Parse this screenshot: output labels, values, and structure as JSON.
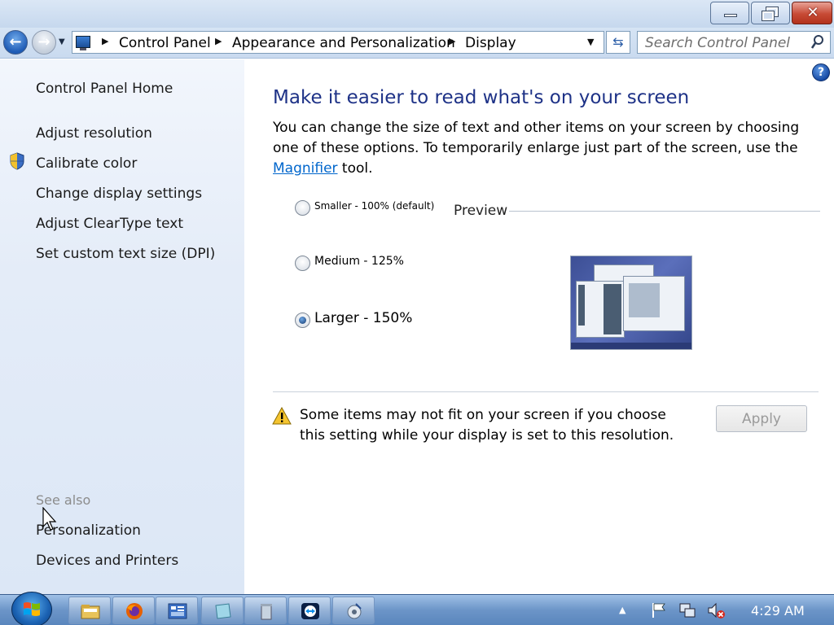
{
  "window": {
    "minimize_label": "",
    "close_glyph": "✕"
  },
  "nav": {
    "back_glyph": "←",
    "forward_glyph": "→",
    "breadcrumbs": [
      "Control Panel",
      "Appearance and Personalization",
      "Display"
    ],
    "search_placeholder": "Search Control Panel"
  },
  "sidebar": {
    "home": "Control Panel Home",
    "links": [
      "Adjust resolution",
      "Calibrate color",
      "Change display settings",
      "Adjust ClearType text",
      "Set custom text size (DPI)"
    ],
    "see_also_label": "See also",
    "see_also_links": [
      "Personalization",
      "Devices and Printers"
    ]
  },
  "main": {
    "title": "Make it easier to read what's on your screen",
    "desc_before": "You can change the size of text and other items on your screen by choosing one of these options. To temporarily enlarge just part of the screen, use the ",
    "desc_link": "Magnifier",
    "desc_after": " tool.",
    "options": [
      {
        "label": "Smaller - 100% (default)",
        "checked": false
      },
      {
        "label": "Medium - 125%",
        "checked": false
      },
      {
        "label": "Larger - 150%",
        "checked": true
      }
    ],
    "preview_label": "Preview",
    "warning": "Some items may not fit on your screen if you choose this setting while your display is set to this resolution.",
    "apply_label": "Apply"
  },
  "taskbar": {
    "apps": [
      "file-explorer-icon",
      "firefox-icon",
      "control-panel-icon",
      "notepad-icon",
      "recycle-icon",
      "teamviewer-icon",
      "disk-tool-icon"
    ],
    "clock": "4:29 AM"
  },
  "colors": {
    "title_blue": "#1e3287",
    "link_blue": "#0066cc"
  }
}
